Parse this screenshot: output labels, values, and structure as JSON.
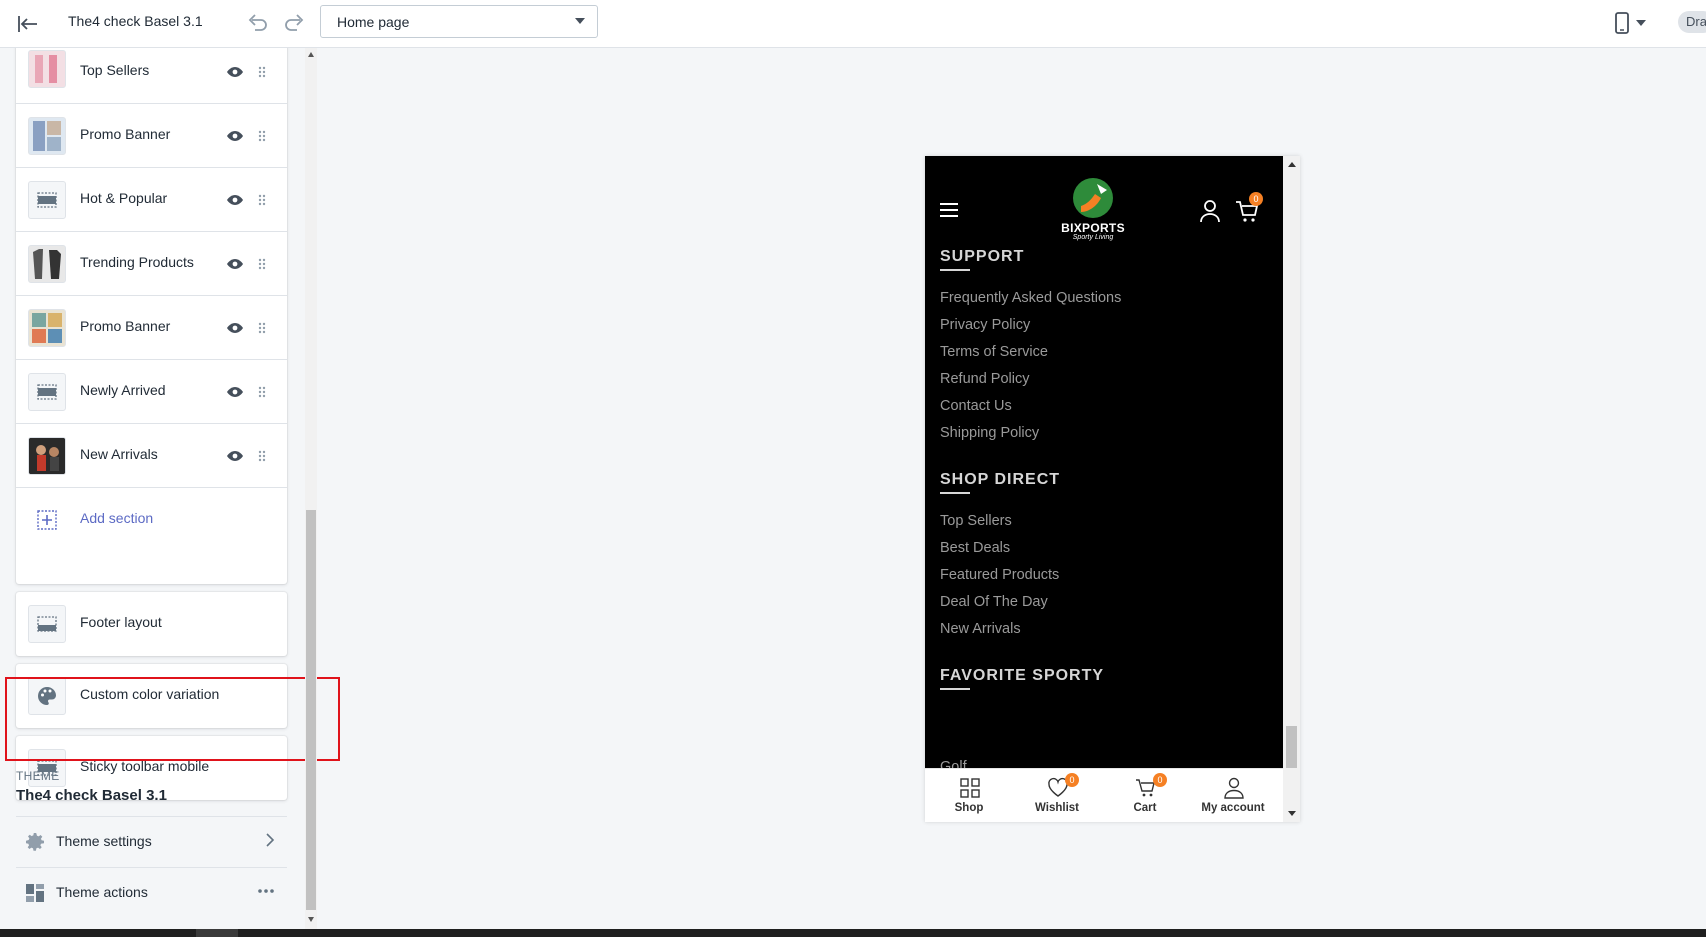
{
  "topbar": {
    "title": "The4 check Basel 3.1",
    "page_select": "Home page",
    "draft_badge": "Draft"
  },
  "sections": [
    {
      "label": "Top Sellers",
      "thumb": "image"
    },
    {
      "label": "Promo Banner",
      "thumb": "image"
    },
    {
      "label": "Hot & Popular",
      "thumb": "layout-icon"
    },
    {
      "label": "Trending Products",
      "thumb": "image"
    },
    {
      "label": "Promo Banner",
      "thumb": "image"
    },
    {
      "label": "Newly Arrived",
      "thumb": "layout-icon"
    },
    {
      "label": "New Arrivals",
      "thumb": "image"
    }
  ],
  "add_section": "Add section",
  "footer_layout": "Footer layout",
  "custom_color": "Custom color variation",
  "sticky_toolbar": "Sticky toolbar mobile",
  "theme": {
    "caption": "THEME",
    "name": "The4 check Basel 3.1",
    "settings": "Theme settings",
    "actions": "Theme actions"
  },
  "preview": {
    "brand": "BIXPORTS",
    "tagline": "Sporty Living",
    "cart_count": "0",
    "support_heading": "SUPPORT",
    "support_links": [
      "Frequently Asked Questions",
      "Privacy Policy",
      "Terms of Service",
      "Refund Policy",
      "Contact Us",
      "Shipping Policy"
    ],
    "shop_heading": "SHOP DIRECT",
    "shop_links": [
      "Top Sellers",
      "Best Deals",
      "Featured Products",
      "Deal Of The Day",
      "New Arrivals"
    ],
    "fav_heading": "FAVORITE SPORTY",
    "fav_partial": "Golf",
    "toolbar": [
      {
        "label": "Shop",
        "icon": "grid-icon",
        "badge": ""
      },
      {
        "label": "Wishlist",
        "icon": "heart-icon",
        "badge": "0"
      },
      {
        "label": "Cart",
        "icon": "cart-icon",
        "badge": "0"
      },
      {
        "label": "My account",
        "icon": "user-icon",
        "badge": ""
      }
    ]
  },
  "colors": {
    "accent": "#5c6ac4",
    "highlight": "#e0131b",
    "badge": "#f58024",
    "logo_green": "#2e8b3a"
  }
}
